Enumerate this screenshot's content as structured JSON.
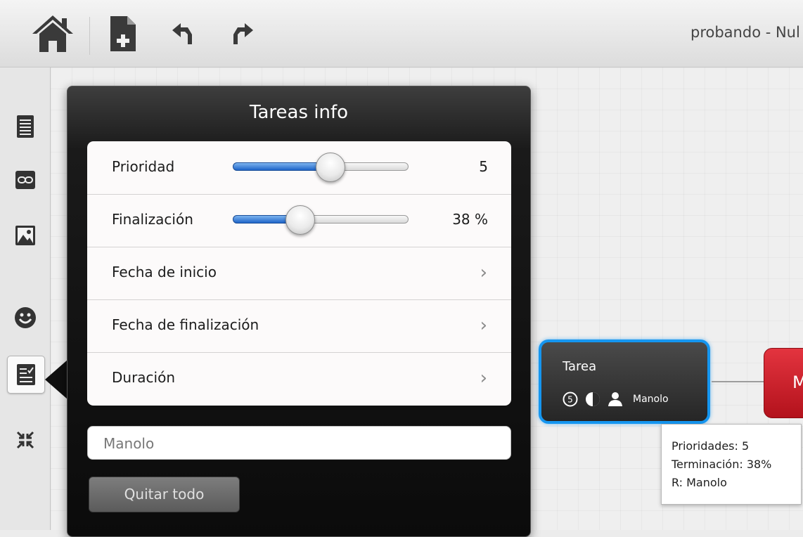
{
  "toolbar": {
    "icons": [
      "home-icon",
      "new-document-icon",
      "undo-icon",
      "redo-icon"
    ],
    "doc_title": "probando - Nul"
  },
  "sidebar": {
    "items": [
      {
        "icon": "notes-icon"
      },
      {
        "icon": "link-icon"
      },
      {
        "icon": "image-icon"
      },
      {
        "icon": "smiley-icon"
      },
      {
        "icon": "task-icon",
        "active": true
      },
      {
        "icon": "collapse-icon"
      }
    ]
  },
  "panel": {
    "title": "Tareas info",
    "rows": [
      {
        "label": "Prioridad",
        "value": "5",
        "slider_fraction": 0.55
      },
      {
        "label": "Finalización",
        "value": "38 %",
        "slider_fraction": 0.38
      },
      {
        "label": "Fecha de inicio"
      },
      {
        "label": "Fecha de finalización"
      },
      {
        "label": "Duración"
      }
    ],
    "responsible_value": "Manolo",
    "remove_all_label": "Quitar todo"
  },
  "node": {
    "title": "Tarea",
    "priority_badge": "5",
    "owner": "Manolo",
    "accent": "#1596f0"
  },
  "red_node": {
    "label": "M",
    "color": "#d0202b"
  },
  "tooltip": {
    "line1": "Prioridades: 5",
    "line2": "Terminación: 38%",
    "line3": "R: Manolo"
  }
}
